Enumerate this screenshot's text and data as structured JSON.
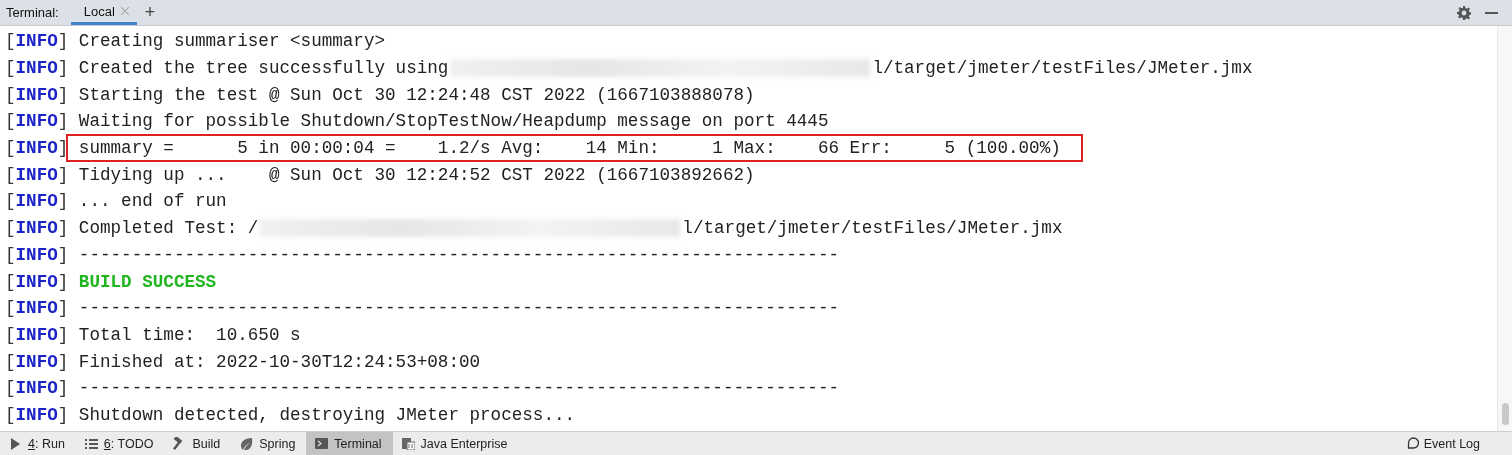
{
  "header": {
    "label": "Terminal:",
    "tabs": [
      {
        "label": "Local",
        "selected": true,
        "closable": true
      }
    ],
    "add_button": "+"
  },
  "lines": [
    {
      "level": "[**INFO**]",
      "text": "Creating summariser <summary>"
    },
    {
      "level": "[**INFO**]",
      "text": "Created the tree successfully using",
      "redacted": true,
      "suffix": "l/target/jmeter/testFiles/JMeter.jmx"
    },
    {
      "level": "[**INFO**]",
      "text": "Starting the test @ Sun Oct 30 12:24:48 CST 2022 (1667103888078)"
    },
    {
      "level": "[**INFO**]",
      "text": "Waiting for possible Shutdown/StopTestNow/Heapdump message on port 4445"
    },
    {
      "level": "[**INFO**]",
      "text": "summary =      5 in 00:00:04 =    1.2/s Avg:    14 Min:     1 Max:    66 Err:     5 (100.00%)",
      "highlighted": true
    },
    {
      "level": "[**INFO**]",
      "text": "Tidying up ...    @ Sun Oct 30 12:24:52 CST 2022 (1667103892662)"
    },
    {
      "level": "[**INFO**]",
      "text": "... end of run"
    },
    {
      "level": "[**INFO**]",
      "text": "Completed Test: /",
      "redacted": true,
      "suffix": "l/target/jmeter/testFiles/JMeter.jmx"
    },
    {
      "level": "[**INFO**]",
      "text": "------------------------------------------------------------------------"
    },
    {
      "level": "[**INFO**]",
      "text": "BUILD SUCCESS",
      "kind": "success"
    },
    {
      "level": "[**INFO**]",
      "text": "------------------------------------------------------------------------"
    },
    {
      "level": "[**INFO**]",
      "text": "Total time:  10.650 s"
    },
    {
      "level": "[**INFO**]",
      "text": "Finished at: 2022-10-30T12:24:53+08:00"
    },
    {
      "level": "[**INFO**]",
      "text": "------------------------------------------------------------------------"
    },
    {
      "level": "[**INFO**]",
      "text": "Shutdown detected, destroying JMeter process..."
    }
  ],
  "tool_windows": [
    {
      "kind": "run",
      "mnemonic": "4",
      "label": ": Run",
      "selected": false
    },
    {
      "kind": "todo",
      "mnemonic": "6",
      "label": ": TODO",
      "selected": false
    },
    {
      "kind": "build",
      "label": "Build",
      "selected": false
    },
    {
      "kind": "spring",
      "label": "Spring",
      "selected": false
    },
    {
      "kind": "terminal",
      "label": "Terminal",
      "selected": true
    },
    {
      "kind": "javaee",
      "label": "Java Enterprise",
      "selected": false
    }
  ],
  "event_log": "Event Log"
}
